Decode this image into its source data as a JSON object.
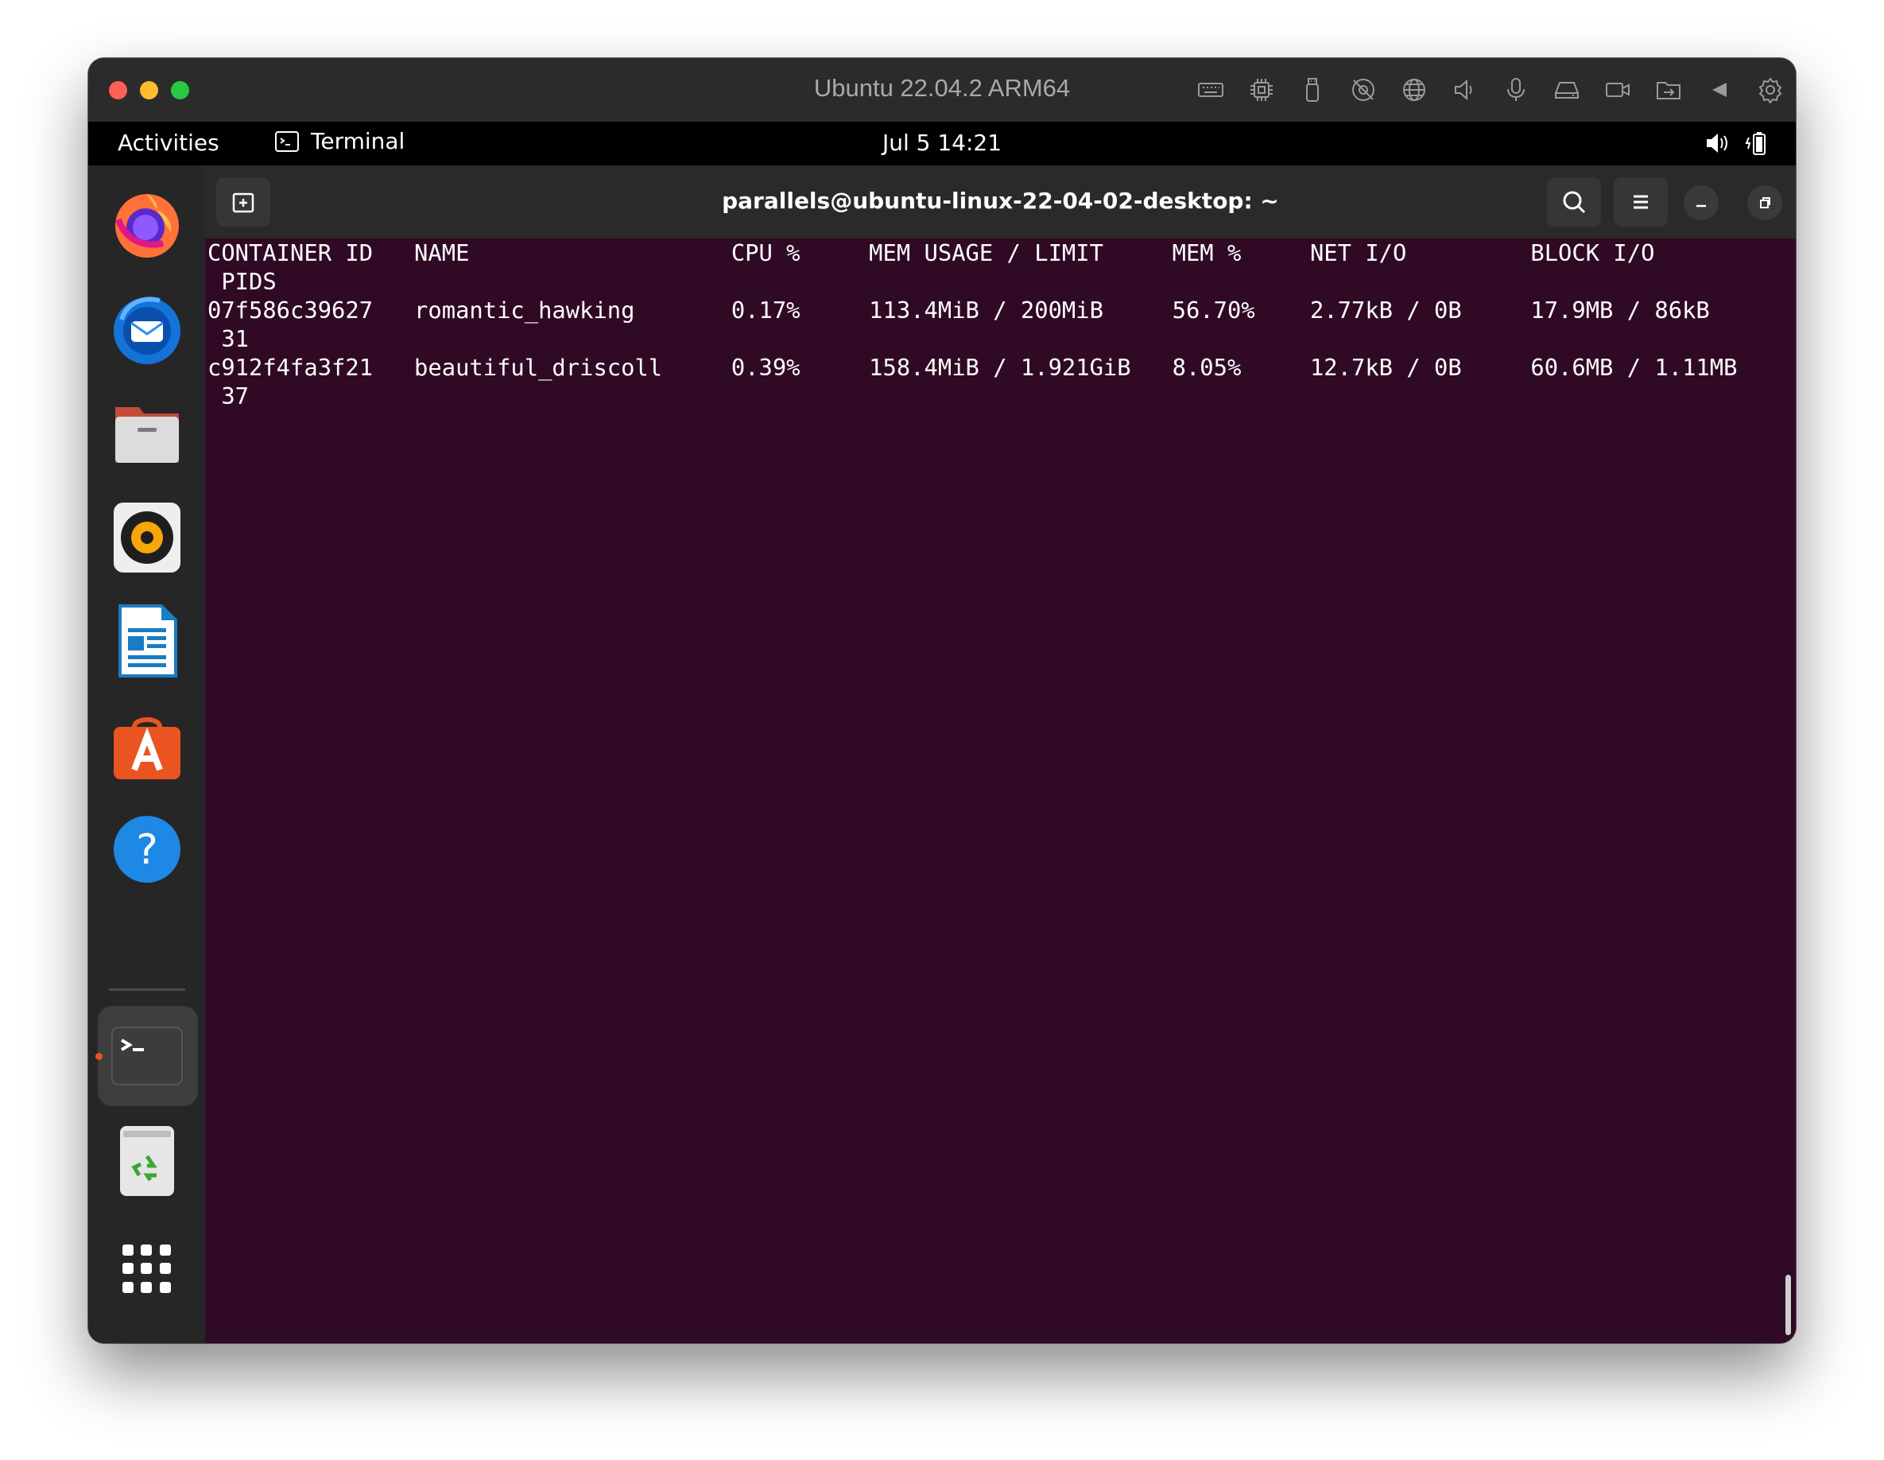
{
  "vm": {
    "title": "Ubuntu 22.04.2 ARM64",
    "toolbar_icons": [
      "keyboard-icon",
      "cpu-icon",
      "usb-icon",
      "camera-off-icon",
      "network-globe-icon",
      "speaker-icon",
      "microphone-icon",
      "disk-drive-icon",
      "camera-icon",
      "shared-folder-icon",
      "back-arrow-icon",
      "settings-gear-icon"
    ]
  },
  "topbar": {
    "activities": "Activities",
    "app_name": "Terminal",
    "clock": "Jul 5  14:21",
    "tray_icons": [
      "volume-icon",
      "battery-icon"
    ]
  },
  "dock": {
    "items": [
      "firefox-icon",
      "thunderbird-icon",
      "files-icon",
      "rhythmbox-icon",
      "libreoffice-writer-icon",
      "app-center-icon",
      "help-icon",
      "terminal-icon",
      "trash-icon"
    ],
    "show_apps_icon": "show-apps-grid-icon"
  },
  "terminal": {
    "title": "parallels@ubuntu-linux-22-04-02-desktop: ~",
    "lines": [
      "CONTAINER ID   NAME                   CPU %     MEM USAGE / LIMIT     MEM %     NET I/O         BLOCK I/O",
      " PIDS",
      "07f586c39627   romantic_hawking       0.17%     113.4MiB / 200MiB     56.70%    2.77kB / 0B     17.9MB / 86kB",
      " 31",
      "c912f4fa3f21   beautiful_driscoll     0.39%     158.4MiB / 1.921GiB   8.05%     12.7kB / 0B     60.6MB / 1.11MB",
      " 37"
    ]
  },
  "colors": {
    "terminal_bg": "#300a24",
    "topbar_bg": "#000000",
    "dock_bg": "#262626",
    "accent": "#e95420"
  }
}
